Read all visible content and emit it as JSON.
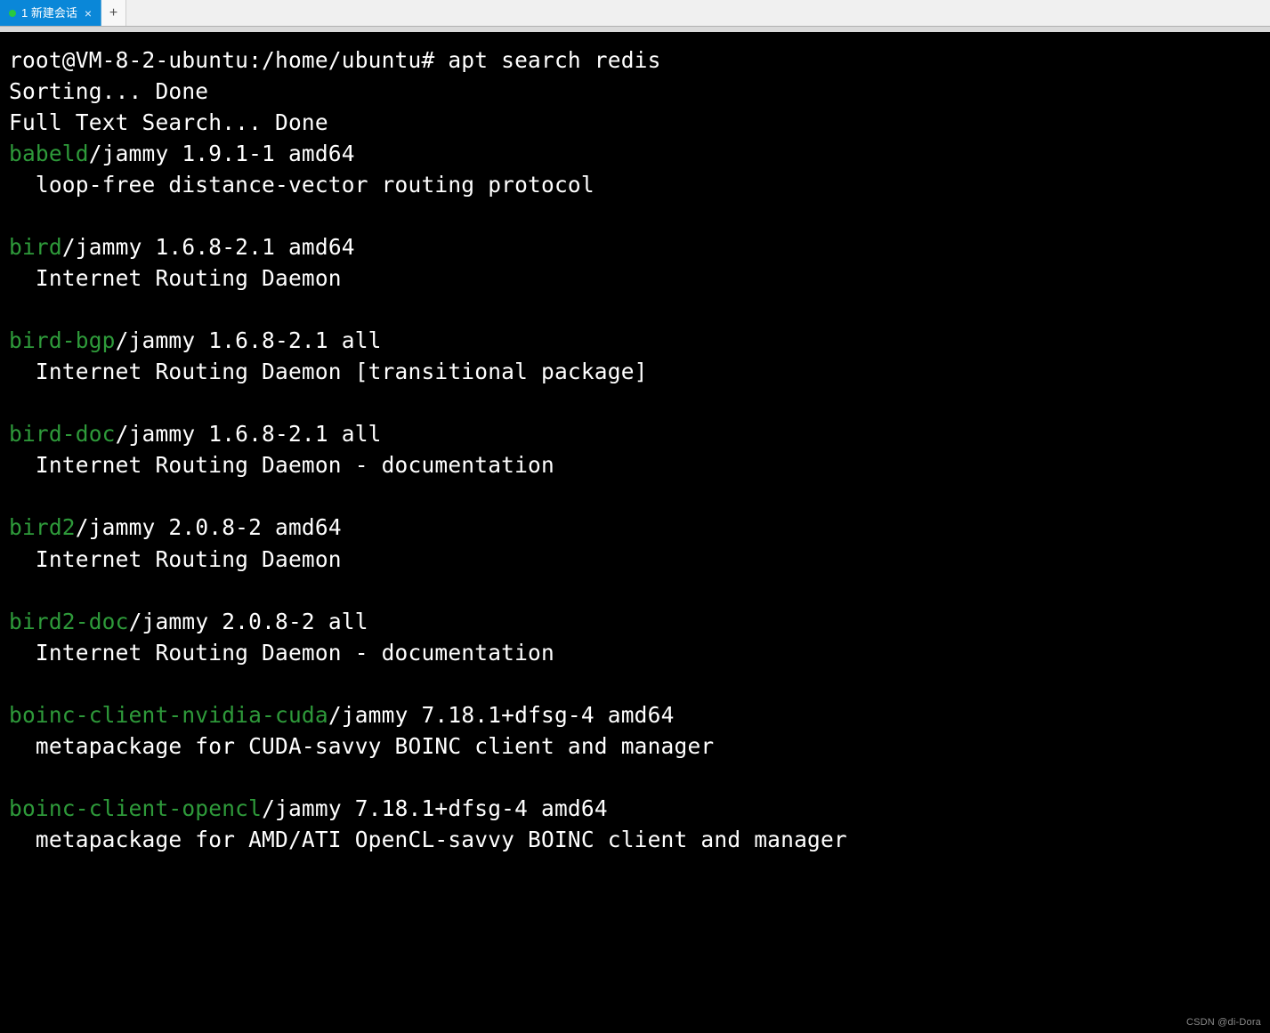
{
  "tab": {
    "label": "1 新建会话",
    "close_glyph": "×",
    "newtab_glyph": "+"
  },
  "terminal": {
    "prompt": "root@VM-8-2-ubuntu:/home/ubuntu# ",
    "command": "apt search redis",
    "status1": "Sorting... Done",
    "status2": "Full Text Search... Done",
    "packages": [
      {
        "name": "babeld",
        "meta": "/jammy 1.9.1-1 amd64",
        "desc": "  loop-free distance-vector routing protocol"
      },
      {
        "name": "bird",
        "meta": "/jammy 1.6.8-2.1 amd64",
        "desc": "  Internet Routing Daemon"
      },
      {
        "name": "bird-bgp",
        "meta": "/jammy 1.6.8-2.1 all",
        "desc": "  Internet Routing Daemon [transitional package]"
      },
      {
        "name": "bird-doc",
        "meta": "/jammy 1.6.8-2.1 all",
        "desc": "  Internet Routing Daemon - documentation"
      },
      {
        "name": "bird2",
        "meta": "/jammy 2.0.8-2 amd64",
        "desc": "  Internet Routing Daemon"
      },
      {
        "name": "bird2-doc",
        "meta": "/jammy 2.0.8-2 all",
        "desc": "  Internet Routing Daemon - documentation"
      },
      {
        "name": "boinc-client-nvidia-cuda",
        "meta": "/jammy 7.18.1+dfsg-4 amd64",
        "desc": "  metapackage for CUDA-savvy BOINC client and manager"
      },
      {
        "name": "boinc-client-opencl",
        "meta": "/jammy 7.18.1+dfsg-4 amd64",
        "desc": "  metapackage for AMD/ATI OpenCL-savvy BOINC client and manager"
      }
    ]
  },
  "watermark": "CSDN @di-Dora"
}
